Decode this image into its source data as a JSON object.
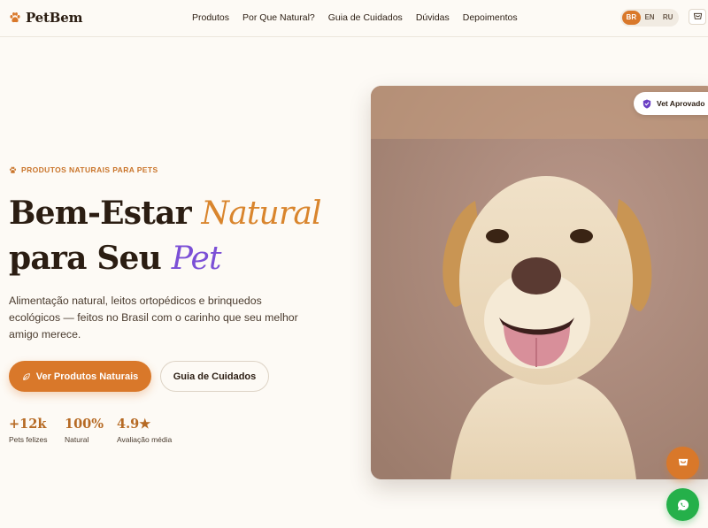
{
  "brand": {
    "name": "PetBem"
  },
  "nav": {
    "items": [
      "Produtos",
      "Por Que Natural?",
      "Guia de Cuidados",
      "Dúvidas",
      "Depoimentos"
    ]
  },
  "languages": {
    "options": [
      "BR",
      "EN",
      "RU"
    ],
    "selected": "BR"
  },
  "hero": {
    "eyebrow": "PRODUTOS NATURAIS PARA PETS",
    "title_part1": "Bem-Estar ",
    "title_accent1": "Natural",
    "title_part2": "para Seu ",
    "title_accent2": "Pet",
    "description": "Alimentação natural, leitos ortopédicos e brinquedos ecológicos — feitos no Brasil com o carinho que seu melhor amigo merece.",
    "primary_cta": "Ver Produtos Naturais",
    "secondary_cta": "Guia de Cuidados"
  },
  "stats": [
    {
      "value": "+12k",
      "label": "Pets felizes"
    },
    {
      "value": "100%",
      "label": "Natural"
    },
    {
      "value": "4.9★",
      "label": "Avaliação média"
    }
  ],
  "badge": {
    "label": "Vet Aprovado"
  },
  "icons": {
    "logo": "paw-icon",
    "cart": "cart-icon",
    "eyebrow": "paw-icon",
    "primary_cta": "leaf-icon",
    "badge": "shield-check-icon",
    "fab_cart": "cart-icon",
    "fab_chat": "whatsapp-icon"
  },
  "colors": {
    "accent": "#d9782a",
    "accent_text": "#d9852d",
    "purple": "#7b4fd6",
    "whatsapp": "#25b04a",
    "background": "#fdfaf5"
  }
}
